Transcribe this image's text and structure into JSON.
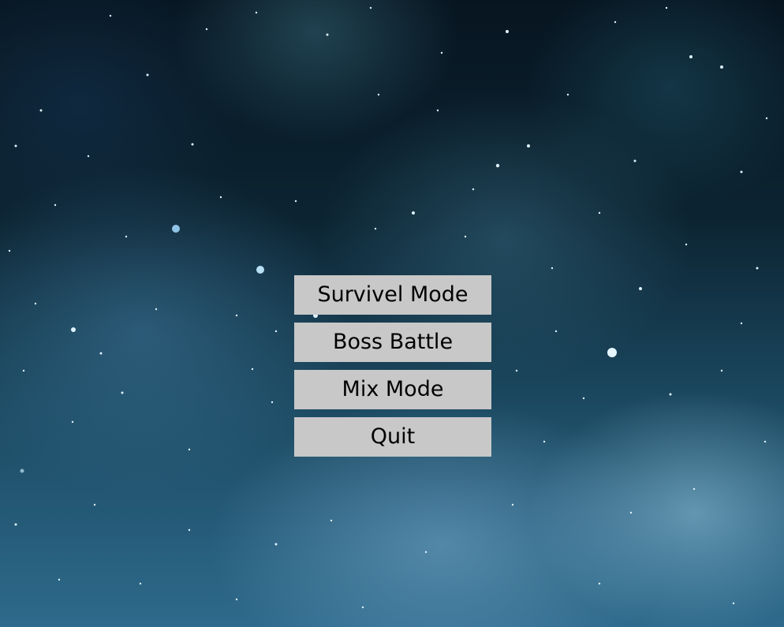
{
  "menu": {
    "buttons": [
      {
        "label": "Survivel Mode"
      },
      {
        "label": "Boss Battle"
      },
      {
        "label": "Mix Mode"
      },
      {
        "label": "Quit"
      }
    ]
  },
  "colors": {
    "button_background": "#c8c8c8",
    "button_text": "#000000",
    "space_dark": "#071520",
    "nebula_light": "#9cc8e0"
  }
}
